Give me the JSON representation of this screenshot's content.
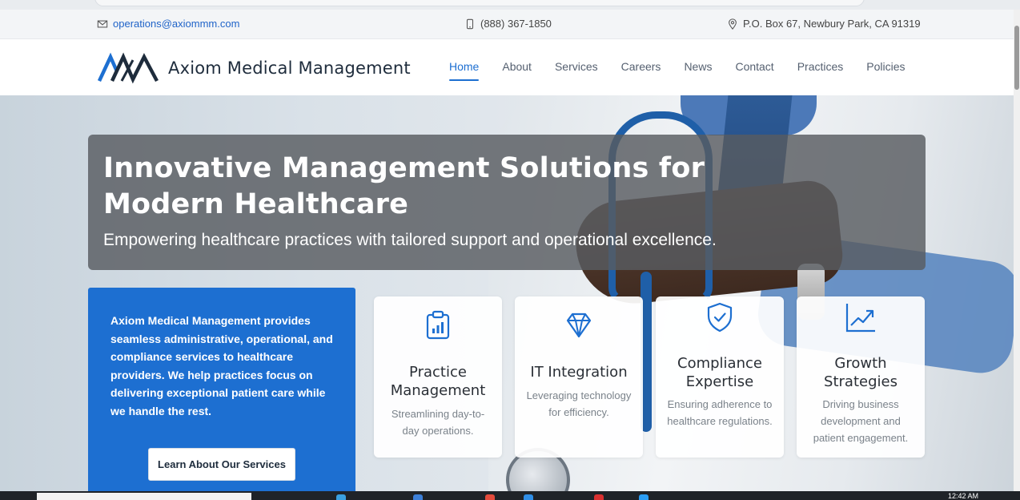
{
  "topbar": {
    "email": "operations@axiommm.com",
    "phone": "(888) 367-1850",
    "address": "P.O. Box 67, Newbury Park, CA 91319"
  },
  "header": {
    "brand": "Axiom Medical Management",
    "nav": [
      "Home",
      "About",
      "Services",
      "Careers",
      "News",
      "Contact",
      "Practices",
      "Policies"
    ],
    "active_nav": "Home"
  },
  "hero": {
    "title": "Innovative Management Solutions for Modern Healthcare",
    "subtitle": "Empowering healthcare practices with tailored support and operational excellence."
  },
  "intro": {
    "text": "Axiom Medical Management provides seamless administrative, operational, and compliance services to healthcare providers. We help practices focus on delivering exceptional patient care while we handle the rest.",
    "button": "Learn About Our Services"
  },
  "cards": [
    {
      "icon": "clipboard-chart-icon",
      "title": "Practice Management",
      "desc": "Streamlining day-to-day operations."
    },
    {
      "icon": "diamond-icon",
      "title": "IT Integration",
      "desc": "Leveraging technology for efficiency."
    },
    {
      "icon": "shield-check-icon",
      "title": "Compliance Expertise",
      "desc": "Ensuring adherence to healthcare regulations."
    },
    {
      "icon": "growth-chart-icon",
      "title": "Growth Strategies",
      "desc": "Driving business development and patient engagement."
    }
  ],
  "taskbar": {
    "clock": "12:42 AM"
  },
  "colors": {
    "accent": "#1d6fd1",
    "brand_dark": "#1e2c3c",
    "banner": "#585c60"
  }
}
